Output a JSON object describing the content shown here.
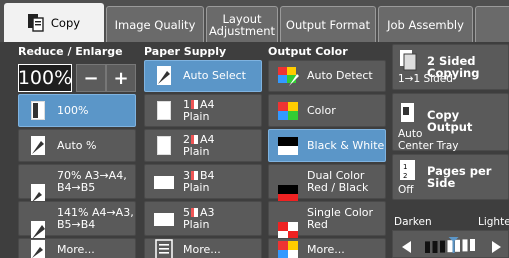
{
  "tabs": [
    {
      "label": "Copy",
      "active": true
    },
    {
      "label": "Image Quality",
      "active": false
    },
    {
      "label": "Layout\nAdjustment",
      "active": false
    },
    {
      "label": "Output Format",
      "active": false
    },
    {
      "label": "Job Assembly",
      "active": false
    }
  ],
  "reduce": {
    "title": "Reduce / Enlarge",
    "zoom_value": "100%",
    "minus": "−",
    "plus": "+",
    "options": [
      "100%",
      "Auto %",
      "70% A3→A4,\nB4→B5",
      "141% A4→A3,\nB5→B4",
      "More..."
    ],
    "selected_index": 0
  },
  "paper": {
    "title": "Paper Supply",
    "options": [
      {
        "line1": "Auto Select",
        "line2": ""
      },
      {
        "line1": "1 A4",
        "line2": "Plain"
      },
      {
        "line1": "2 A4",
        "line2": "Plain"
      },
      {
        "line1": "3 B4",
        "line2": "Plain"
      },
      {
        "line1": "5 A3",
        "line2": "Plain"
      },
      {
        "line1": "More...",
        "line2": ""
      }
    ],
    "selected_index": 0
  },
  "output_color": {
    "title": "Output Color",
    "options": [
      "Auto Detect",
      "Color",
      "Black & White",
      "Dual Color\nRed / Black",
      "Single Color\nRed",
      "More..."
    ],
    "selected_index": 2
  },
  "right": {
    "two_sided": {
      "title": "2 Sided Copying",
      "value": "1→1 Sided"
    },
    "copy_output": {
      "title": "Copy Output",
      "value": "Auto\nCenter Tray"
    },
    "pages_per_side": {
      "title": "Pages per Side",
      "value": "Off"
    },
    "darken_label": "Darken",
    "lighter_label": "Lighter",
    "density_level": 0.55
  },
  "colors": {
    "selected": "#5b96c8",
    "button": "#5a5a5a",
    "background": "#3e3e3e"
  }
}
